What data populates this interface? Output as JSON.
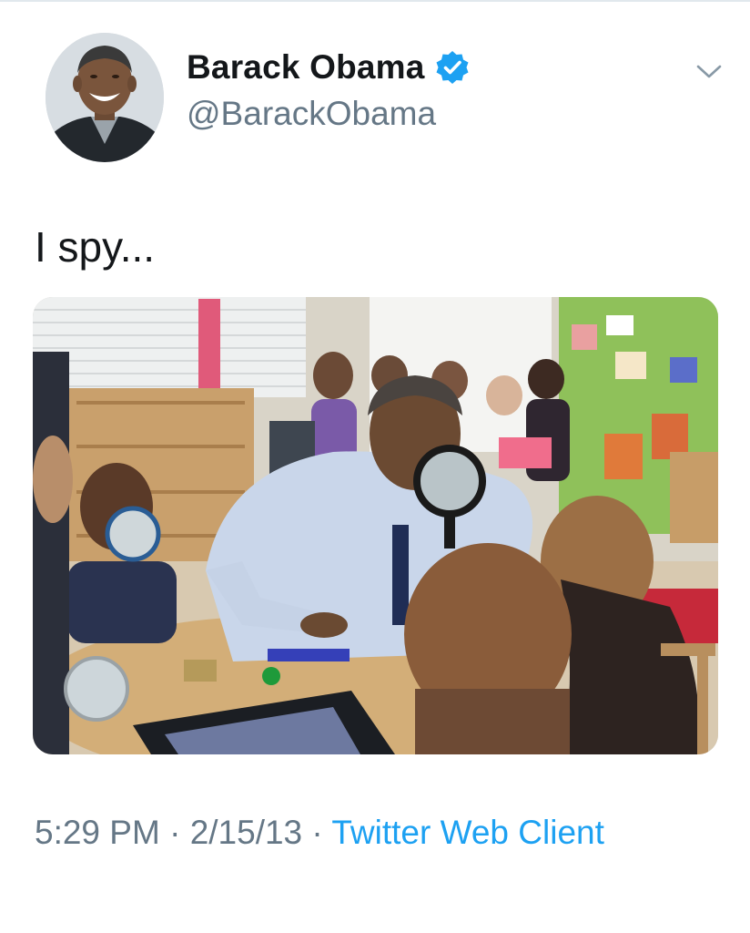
{
  "tweet": {
    "author": {
      "display_name": "Barack Obama",
      "handle": "@BarackObama",
      "verified_icon": "verified-badge-icon",
      "avatar_icon": "profile-photo"
    },
    "text": "I spy...",
    "media": {
      "icon": "photo"
    },
    "timestamp": {
      "time": "5:29 PM",
      "separator": " · ",
      "date": "2/15/13",
      "separator2": " · ",
      "source": "Twitter Web Client"
    },
    "menu_icon": "chevron-down-icon"
  },
  "colors": {
    "link": "#1da1f2",
    "secondary_text": "#657786",
    "primary_text": "#14171a",
    "verified": "#1da1f2"
  }
}
